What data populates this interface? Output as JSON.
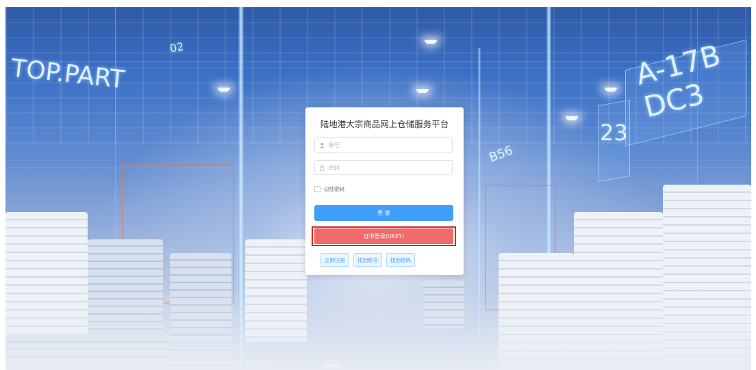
{
  "background": {
    "left_sign": "TOP.PART",
    "right_sign": "A-17B DC3",
    "right_number": "23",
    "aisle_label": "B56",
    "overhead_label": "02",
    "copyright": "Copyri"
  },
  "login": {
    "title": "陆地港大宗商品网上仓储服务平台",
    "account_placeholder": "账号",
    "password_placeholder": "密码",
    "remember_label": "记住密码",
    "login_button": "登 录",
    "cert_button": "证书登录(UKEY)",
    "register_link": "立即注册",
    "find_account_link": "找回账号",
    "find_password_link": "找回密码"
  },
  "colors": {
    "primary": "#409eff",
    "danger": "#ef6a6a",
    "highlight": "#e02424"
  },
  "icons": {
    "account": "user-icon",
    "password": "lock-icon"
  }
}
